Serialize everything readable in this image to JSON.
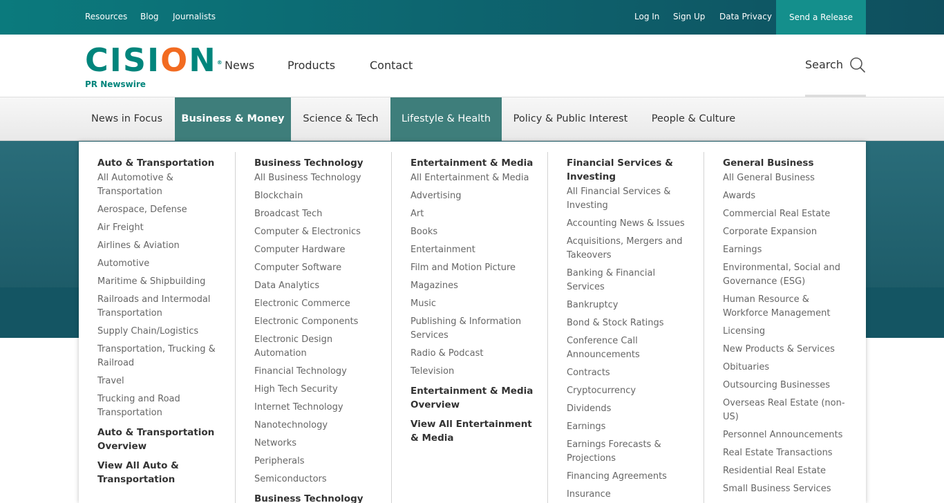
{
  "topbar": {
    "links_left": [
      "Resources",
      "Blog",
      "Journalists"
    ],
    "links_right": [
      "Log In",
      "Sign Up",
      "Data Privacy"
    ],
    "send_release": "Send a Release"
  },
  "header": {
    "logo_word_a": "CISI",
    "logo_word_o": "O",
    "logo_word_b": "N",
    "logo_sub": "PR Newswire",
    "nav": [
      "News",
      "Products",
      "Contact"
    ],
    "search_label": "Search"
  },
  "categories": [
    "News in Focus",
    "Business & Money",
    "Science & Tech",
    "Lifestyle & Health",
    "Policy & Public Interest",
    "People & Culture"
  ],
  "menu": {
    "columns": [
      {
        "title": "Auto & Transportation",
        "items": [
          "All Automotive & Transportation",
          "Aerospace, Defense",
          "Air Freight",
          "Airlines & Aviation",
          "Automotive",
          "Maritime & Shipbuilding",
          "Railroads and Intermodal Transportation",
          "Supply Chain/Logistics",
          "Transportation, Trucking & Railroad",
          "Travel",
          "Trucking and Road Transportation"
        ],
        "overview": "Auto & Transportation Overview",
        "view_all": "View All Auto & Transportation"
      },
      {
        "title": "Business Technology",
        "items": [
          "All Business Technology",
          "Blockchain",
          "Broadcast Tech",
          "Computer & Electronics",
          "Computer Hardware",
          "Computer Software",
          "Data Analytics",
          "Electronic Commerce",
          "Electronic Components",
          "Electronic Design Automation",
          "Financial Technology",
          "High Tech Security",
          "Internet Technology",
          "Nanotechnology",
          "Networks",
          "Peripherals",
          "Semiconductors"
        ],
        "overview": "Business Technology",
        "view_all": ""
      },
      {
        "title": "Entertainment & Media",
        "items": [
          "All Entertainment & Media",
          "Advertising",
          "Art",
          "Books",
          "Entertainment",
          "Film and Motion Picture",
          "Magazines",
          "Music",
          "Publishing & Information Services",
          "Radio & Podcast",
          "Television"
        ],
        "overview": "Entertainment & Media Overview",
        "view_all": "View All Entertainment & Media"
      },
      {
        "title": "Financial Services & Investing",
        "items": [
          "All Financial Services & Investing",
          "Accounting News & Issues",
          "Acquisitions, Mergers and Takeovers",
          "Banking & Financial Services",
          "Bankruptcy",
          "Bond & Stock Ratings",
          "Conference Call Announcements",
          "Contracts",
          "Cryptocurrency",
          "Dividends",
          "Earnings",
          "Earnings Forecasts & Projections",
          "Financing Agreements",
          "Insurance"
        ],
        "overview": "",
        "view_all": ""
      },
      {
        "title": "General Business",
        "items": [
          "All General Business",
          "Awards",
          "Commercial Real Estate",
          "Corporate Expansion",
          "Earnings",
          "Environmental, Social and Governance (ESG)",
          "Human Resource & Workforce Management",
          "Licensing",
          "New Products & Services",
          "Obituaries",
          "Outsourcing Businesses",
          "Overseas Real Estate (non-US)",
          "Personnel Announcements",
          "Real Estate Transactions",
          "Residential Real Estate",
          "Small Business Services"
        ],
        "overview": "",
        "view_all": ""
      }
    ]
  }
}
